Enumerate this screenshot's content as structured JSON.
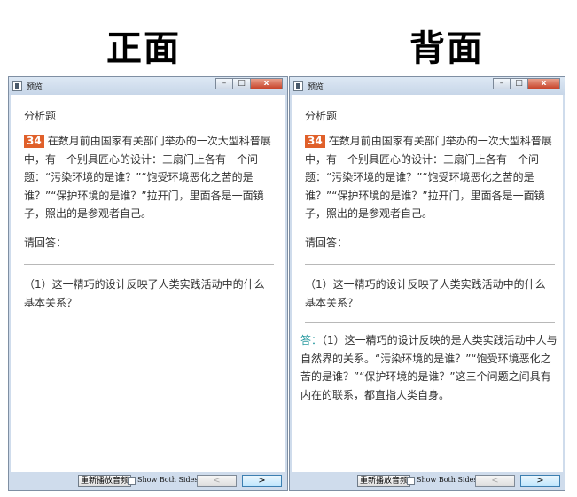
{
  "labels": {
    "front": "正面",
    "back": "背面"
  },
  "window": {
    "title": "预览",
    "controls": {
      "minimize": "–",
      "maximize": "□",
      "close": "x"
    }
  },
  "card": {
    "section": "分析题",
    "question_number": "34",
    "question_text": "在数月前由国家有关部门举办的一次大型科普展中，有一个别具匠心的设计：三扇门上各有一个问题：“污染环境的是谁？”“饱受环境恶化之苦的是谁？”“保护环境的是谁？”拉开门，里面各是一面镜子，照出的是参观者自己。",
    "prompt": "请回答：",
    "sub_question": "（1）这一精巧的设计反映了人类实践活动中的什么基本关系？",
    "answer_label": "答：",
    "answer_text": "（1）这一精巧的设计反映的是人类实践活动中人与自然界的关系。“污染环境的是谁？”“饱受环境恶化之苦的是谁？”“保护环境的是谁？”这三个问题之间具有内在的联系，都直指人类自身。"
  },
  "bottombar": {
    "replay": "重新播放音频",
    "show_both": "Show Both Sides",
    "prev": "<",
    "next": ">"
  },
  "colors": {
    "question_badge": "#e0602a",
    "answer_label": "#2a9aa0",
    "window_frame": "#cfdcec"
  }
}
